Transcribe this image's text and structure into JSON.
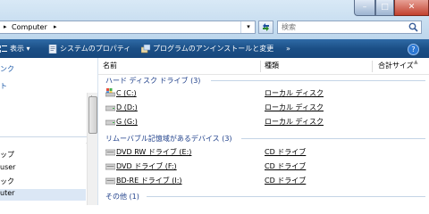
{
  "address": {
    "separator_glyph": "▸",
    "path_label": "Computer",
    "after_glyph": "▸",
    "dropdown_glyph": "▾"
  },
  "search": {
    "placeholder": "検索"
  },
  "window_buttons": {
    "minimize": "–",
    "maximize": "□",
    "close": "✕"
  },
  "toolbar": {
    "items": [
      {
        "label": "表示",
        "icon": "view-icon"
      },
      {
        "label": "システムのプロパティ",
        "icon": "properties-icon"
      },
      {
        "label": "プログラムのアンインストールと変更",
        "icon": "uninstall-icon"
      }
    ],
    "overflow": "»",
    "help": "?"
  },
  "nav": {
    "favorites": [
      "ンク",
      "ト"
    ],
    "chevron": "⌄",
    "folders": [
      "ップ",
      "user",
      "ック",
      "uter"
    ]
  },
  "columns": {
    "name": "名前",
    "type": "種類",
    "total_size": "合計サイズ"
  },
  "groups": {
    "hdd": {
      "title": "ハード ディスク ドライブ (3)",
      "items": [
        {
          "name": "C (C:)",
          "type": "ローカル ディスク"
        },
        {
          "name": "D (D:)",
          "type": "ローカル ディスク"
        },
        {
          "name": "G (G:)",
          "type": "ローカル ディスク"
        }
      ]
    },
    "removable": {
      "title": "リムーバブル記憶域があるデバイス (3)",
      "items": [
        {
          "name": "DVD RW ドライブ (E:)",
          "type": "CD ドライブ"
        },
        {
          "name": "DVD ドライブ (F:)",
          "type": "CD ドライブ"
        },
        {
          "name": "BD-RE ドライブ (I:)",
          "type": "CD ドライブ"
        }
      ]
    },
    "other": {
      "title": "その他 (1)"
    }
  },
  "colors": {
    "toolbar_bg": "#1b4f86",
    "group_text": "#1e3f8a",
    "accent": "#2d78d3"
  }
}
